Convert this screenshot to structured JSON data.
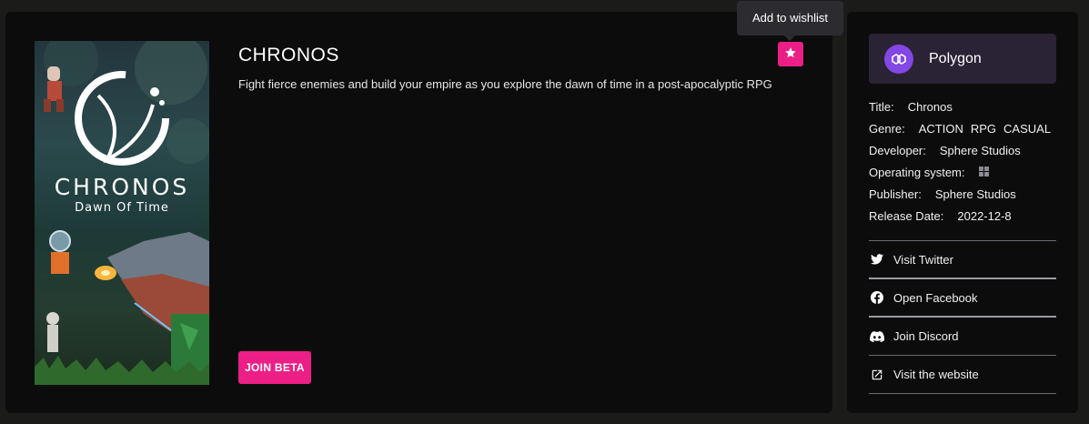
{
  "game": {
    "title": "CHRONOS",
    "description": "Fight fierce enemies and build your empire as you explore the dawn of time in a post-apocalyptic RPG",
    "join_label": "JOIN BETA",
    "wishlist_tooltip": "Add to wishlist",
    "cover": {
      "title": "CHRONOS",
      "subtitle": "Dawn Of Time"
    }
  },
  "sidebar": {
    "chain": "Polygon",
    "info": {
      "title_label": "Title:",
      "title_value": "Chronos",
      "genre_label": "Genre:",
      "genres": [
        "ACTION",
        "RPG",
        "CASUAL"
      ],
      "developer_label": "Developer:",
      "developer_value": "Sphere Studios",
      "os_label": "Operating system:",
      "os_icon": "windows-icon",
      "publisher_label": "Publisher:",
      "publisher_value": "Sphere Studios",
      "release_label": "Release Date:",
      "release_value": "2022-12-8"
    },
    "links": [
      {
        "label": "Visit Twitter",
        "icon": "twitter-icon"
      },
      {
        "label": "Open Facebook",
        "icon": "facebook-icon"
      },
      {
        "label": "Join Discord",
        "icon": "discord-icon"
      },
      {
        "label": "Visit the website",
        "icon": "external-link-icon"
      }
    ]
  },
  "colors": {
    "accent": "#ec1f86",
    "polygon": "#8247e5",
    "card": "#0c0c0d",
    "background": "#1b1b1a"
  }
}
